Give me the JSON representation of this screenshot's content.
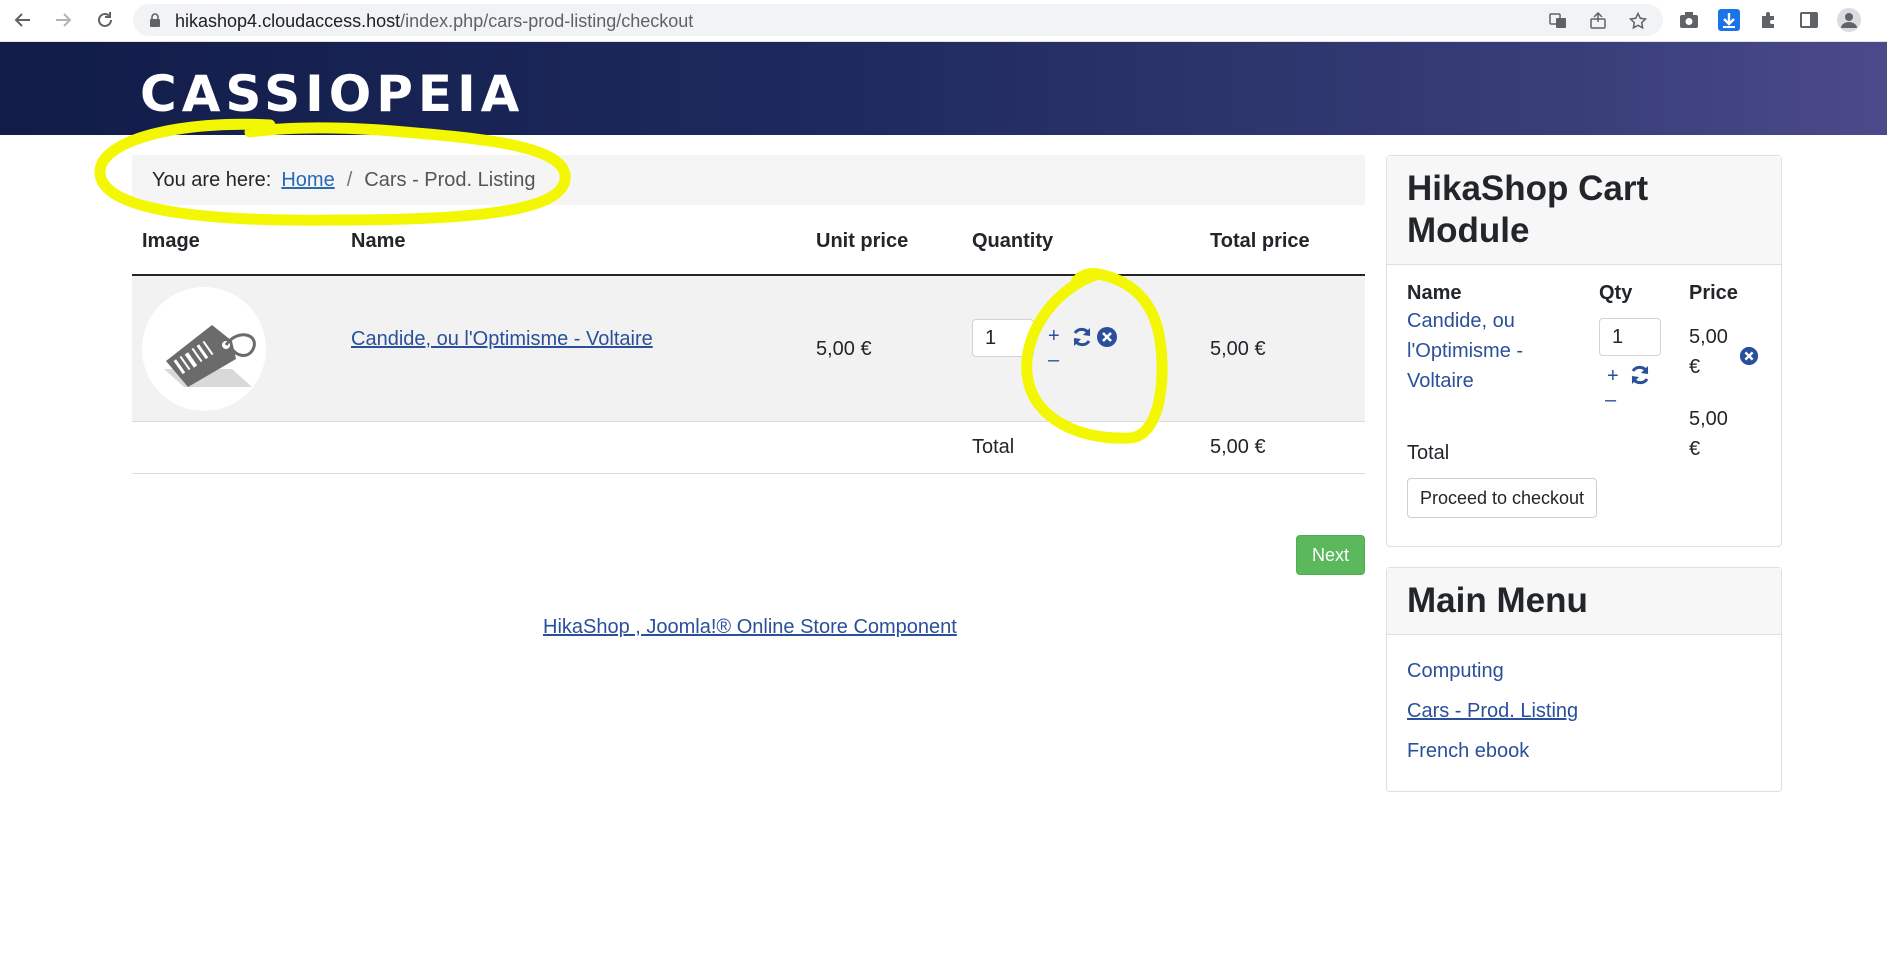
{
  "browser": {
    "url_host": "hikashop4.cloudaccess.host",
    "url_path": "/index.php/cars-prod-listing/checkout"
  },
  "site": {
    "brand": "CASSIOPEIA"
  },
  "breadcrumb": {
    "prefix": "You are here:",
    "home": "Home",
    "separator": "/",
    "current": "Cars - Prod. Listing"
  },
  "cart": {
    "headers": {
      "image": "Image",
      "name": "Name",
      "unit_price": "Unit price",
      "quantity": "Quantity",
      "total_price": "Total price"
    },
    "item": {
      "name": "Candide, ou l'Optimisme - Voltaire",
      "unit_price": "5,00 €",
      "quantity": "1",
      "plus": "+",
      "minus": "–",
      "total_price": "5,00 €"
    },
    "total_label": "Total",
    "total_value": "5,00 €",
    "next_label": "Next"
  },
  "footer": {
    "link": "HikaShop , Joomla!® Online Store Component"
  },
  "cart_module": {
    "title_line1": "HikaShop Cart",
    "title_line2": "Module",
    "headers": {
      "name": "Name",
      "qty": "Qty",
      "price": "Price"
    },
    "item": {
      "name_line1": "Candide, ou",
      "name_line2": "l'Optimisme -",
      "name_line3": "Voltaire",
      "qty": "1",
      "plus": "+",
      "minus": "–",
      "price_line1": "5,00",
      "price_line2": "€"
    },
    "total_label": "Total",
    "total_line1": "5,00",
    "total_line2": "€",
    "checkout_label": "Proceed to checkout"
  },
  "main_menu": {
    "title": "Main Menu",
    "items": [
      {
        "label": "Computing"
      },
      {
        "label": "Cars - Prod. Listing"
      },
      {
        "label": "French ebook"
      }
    ]
  },
  "colors": {
    "link": "#2a4f9b",
    "next_button": "#5cb85c",
    "highlight": "#f4f703",
    "header_dark": "#111c48"
  }
}
